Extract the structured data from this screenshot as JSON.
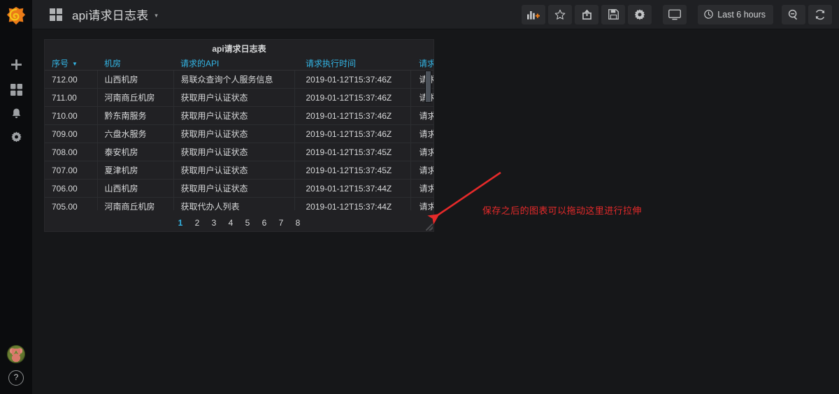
{
  "app": {
    "logo_icon": "grafana-logo-icon",
    "background_color": "#161719",
    "accent_color": "#33b5e5",
    "annotation_color": "#e62a2a"
  },
  "sidebar": {
    "items": [
      {
        "icon": "plus-icon",
        "label": "Create"
      },
      {
        "icon": "dashboards-icon",
        "label": "Dashboards"
      },
      {
        "icon": "bell-icon",
        "label": "Alerting"
      },
      {
        "icon": "gear-icon",
        "label": "Configuration"
      }
    ],
    "bottom_items": [
      {
        "icon": "avatar-icon",
        "label": "User profile"
      },
      {
        "icon": "help-icon",
        "label": "?"
      }
    ]
  },
  "navbar": {
    "dashboard_icon": "dashboard-grid-icon",
    "title": "api请求日志表",
    "caret_glyph": "▾",
    "buttons": [
      {
        "icon": "add-panel-icon",
        "label": "Add panel"
      },
      {
        "icon": "star-icon",
        "label": "Mark as favorite"
      },
      {
        "icon": "share-icon",
        "label": "Share dashboard"
      },
      {
        "icon": "save-icon",
        "label": "Save dashboard"
      },
      {
        "icon": "gear-icon",
        "label": "Dashboard settings"
      },
      {
        "icon": "tv-icon",
        "label": "Cycle view mode"
      }
    ],
    "time_picker": {
      "icon": "clock-icon",
      "value": "Last 6 hours"
    },
    "zoom_out": {
      "icon": "zoom-out-icon",
      "label": "Zoom out time range"
    },
    "refresh": {
      "icon": "refresh-icon",
      "label": "Refresh dashboard"
    }
  },
  "panel": {
    "title": "api请求日志表",
    "resize_handle": "panel-resize-handle",
    "table": {
      "columns": [
        {
          "label": "序号",
          "sorted": true,
          "sort_glyph": "▼"
        },
        {
          "label": "机房",
          "sorted": false,
          "sort_glyph": ""
        },
        {
          "label": "请求的API",
          "sorted": false,
          "sort_glyph": ""
        },
        {
          "label": "请求执行时间",
          "sorted": false,
          "sort_glyph": ""
        },
        {
          "label": "请求结果",
          "sorted": false,
          "sort_glyph": ""
        }
      ],
      "rows": [
        [
          "712.00",
          "山西机房",
          "易联众查询个人服务信息",
          "2019-01-12T15:37:46Z",
          "请求成功"
        ],
        [
          "711.00",
          "河南商丘机房",
          "获取用户认证状态",
          "2019-01-12T15:37:46Z",
          "请求成功"
        ],
        [
          "710.00",
          "黔东南服务",
          "获取用户认证状态",
          "2019-01-12T15:37:46Z",
          "请求成功"
        ],
        [
          "709.00",
          "六盘水服务",
          "获取用户认证状态",
          "2019-01-12T15:37:46Z",
          "请求成功"
        ],
        [
          "708.00",
          "泰安机房",
          "获取用户认证状态",
          "2019-01-12T15:37:45Z",
          "请求成功"
        ],
        [
          "707.00",
          "夏津机房",
          "获取用户认证状态",
          "2019-01-12T15:37:45Z",
          "请求成功"
        ],
        [
          "706.00",
          "山西机房",
          "获取用户认证状态",
          "2019-01-12T15:37:44Z",
          "请求成功"
        ],
        [
          "705.00",
          "河南商丘机房",
          "获取代办人列表",
          "2019-01-12T15:37:44Z",
          "请求成功"
        ]
      ],
      "pagination": {
        "pages": [
          "1",
          "2",
          "3",
          "4",
          "5",
          "6",
          "7",
          "8"
        ],
        "active": "1"
      }
    }
  },
  "annotation": {
    "text": "保存之后的图表可以拖动这里进行拉伸",
    "arrow": "red-arrow-pointing-to-resize-handle"
  }
}
